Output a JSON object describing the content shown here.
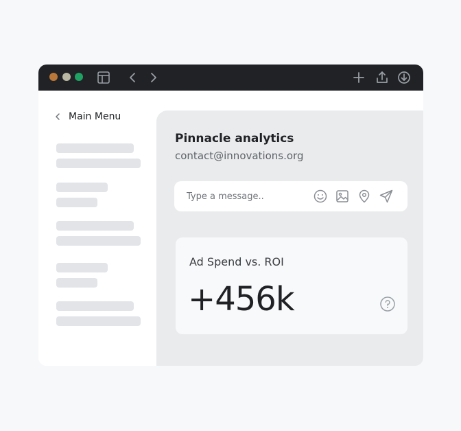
{
  "window": {
    "traffic_lights": [
      {
        "name": "close",
        "color": "#b9773a"
      },
      {
        "name": "minimize",
        "color": "#b9b6a3"
      },
      {
        "name": "maximize",
        "color": "#1ea162"
      }
    ],
    "toolbar_icons": [
      "sidebar-toggle-icon",
      "back-icon",
      "forward-icon",
      "new-tab-icon",
      "share-icon",
      "download-icon"
    ]
  },
  "sidebar": {
    "back_label": "Main Menu"
  },
  "contact": {
    "name": "Pinnacle analytics",
    "email": "contact@innovations.org"
  },
  "composer": {
    "placeholder": "Type a message..",
    "icons": [
      "emoji-icon",
      "image-icon",
      "location-icon",
      "send-icon"
    ]
  },
  "metric_card": {
    "title": "Ad Spend vs. ROI",
    "value": "+456k",
    "help_icon": "help-icon"
  },
  "colors": {
    "titlebar": "#202226",
    "main_panel": "#e9ebed",
    "skeleton": "#e2e4e8",
    "icon_gray": "#8a8e93"
  }
}
